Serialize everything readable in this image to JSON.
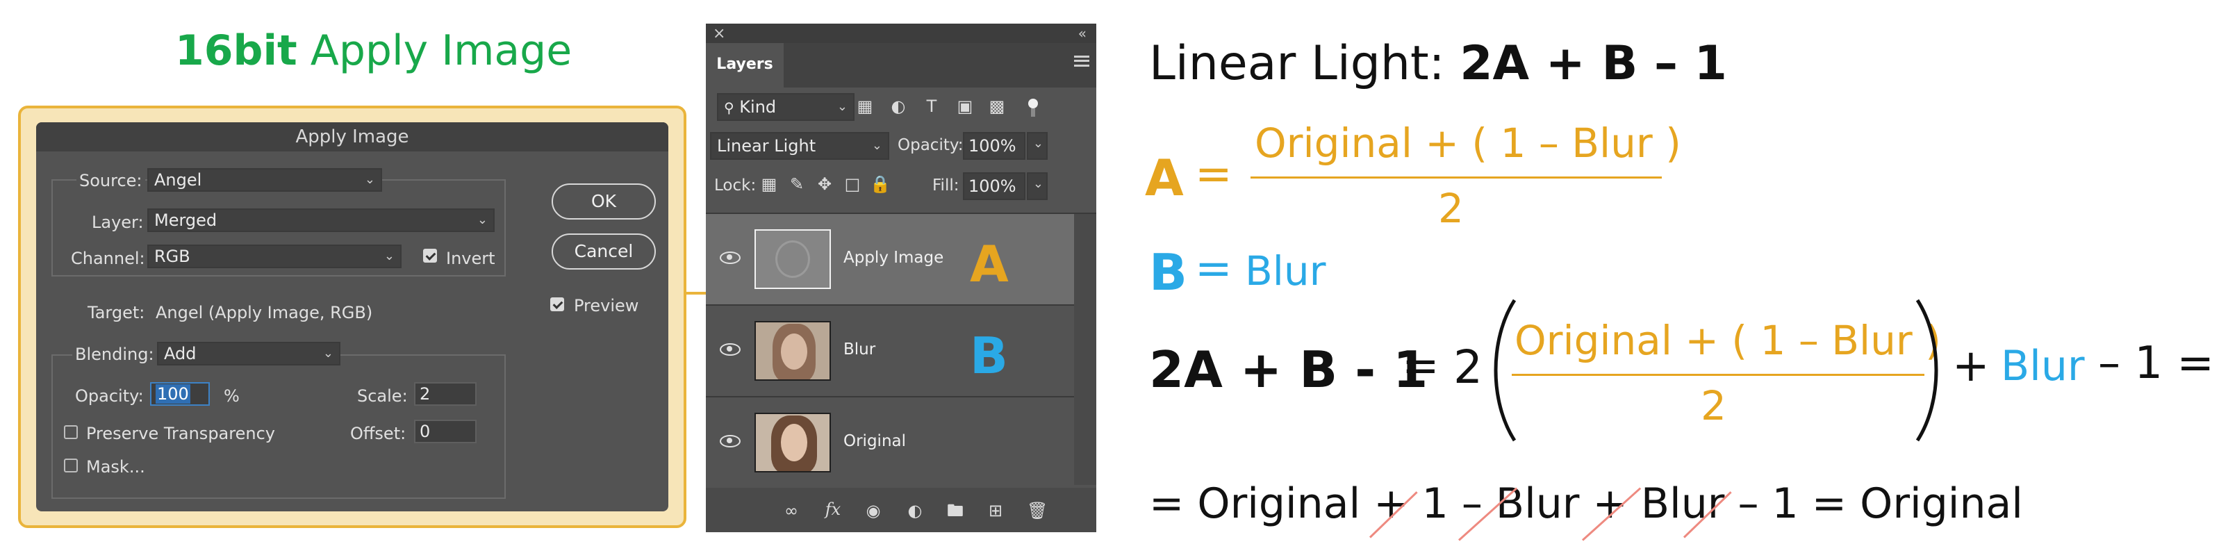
{
  "heading": {
    "bold": "16bit",
    "rest": " Apply Image"
  },
  "dialog": {
    "title": "Apply Image",
    "source_label": "Source:",
    "source_value": "Angel",
    "layer_label": "Layer:",
    "layer_value": "Merged",
    "channel_label": "Channel:",
    "channel_value": "RGB",
    "invert_label": "Invert",
    "target_label": "Target:",
    "target_value": "Angel (Apply Image, RGB)",
    "blending_label": "Blending:",
    "blending_value": "Add",
    "opacity_label": "Opacity:",
    "opacity_value": "100",
    "percent": "%",
    "scale_label": "Scale:",
    "scale_value": "2",
    "offset_label": "Offset:",
    "offset_value": "0",
    "preserve_label": "Preserve Transparency",
    "mask_label": "Mask...",
    "ok_label": "OK",
    "cancel_label": "Cancel",
    "preview_label": "Preview"
  },
  "layers": {
    "tab": "Layers",
    "kind_label": "Kind",
    "blend_mode": "Linear Light",
    "opacity_label": "Opacity:",
    "opacity_value": "100%",
    "lock_label": "Lock:",
    "fill_label": "Fill:",
    "fill_value": "100%",
    "items": [
      {
        "name": "Apply Image",
        "tag": "A"
      },
      {
        "name": "Blur",
        "tag": "B"
      },
      {
        "name": "Original",
        "tag": ""
      }
    ]
  },
  "formula": {
    "title_plain": "Linear Light: ",
    "title_bold": "2A + B – 1",
    "a_letter": "A",
    "eq": "=",
    "a_numerator": "Original + ( 1 – Blur )",
    "a_denominator": "2",
    "b_letter": "B",
    "b_value": "Blur",
    "expand_lhs": "2A + B - 1",
    "expand_two": "2",
    "expand_numerator": "Original + ( 1 – Blur )",
    "expand_denominator": "2",
    "expand_plus": "+",
    "expand_blur": "Blur",
    "expand_tail": "– 1 =",
    "final_parts": [
      "= Original + ",
      "1",
      " – ",
      "Blur",
      " + ",
      "Blur",
      " – ",
      "1",
      " = Original"
    ]
  },
  "colors": {
    "accent_orange": "#e6a520",
    "accent_blue": "#2aa9e6",
    "accent_green": "#18a84a",
    "strike": "#ee8a80"
  }
}
